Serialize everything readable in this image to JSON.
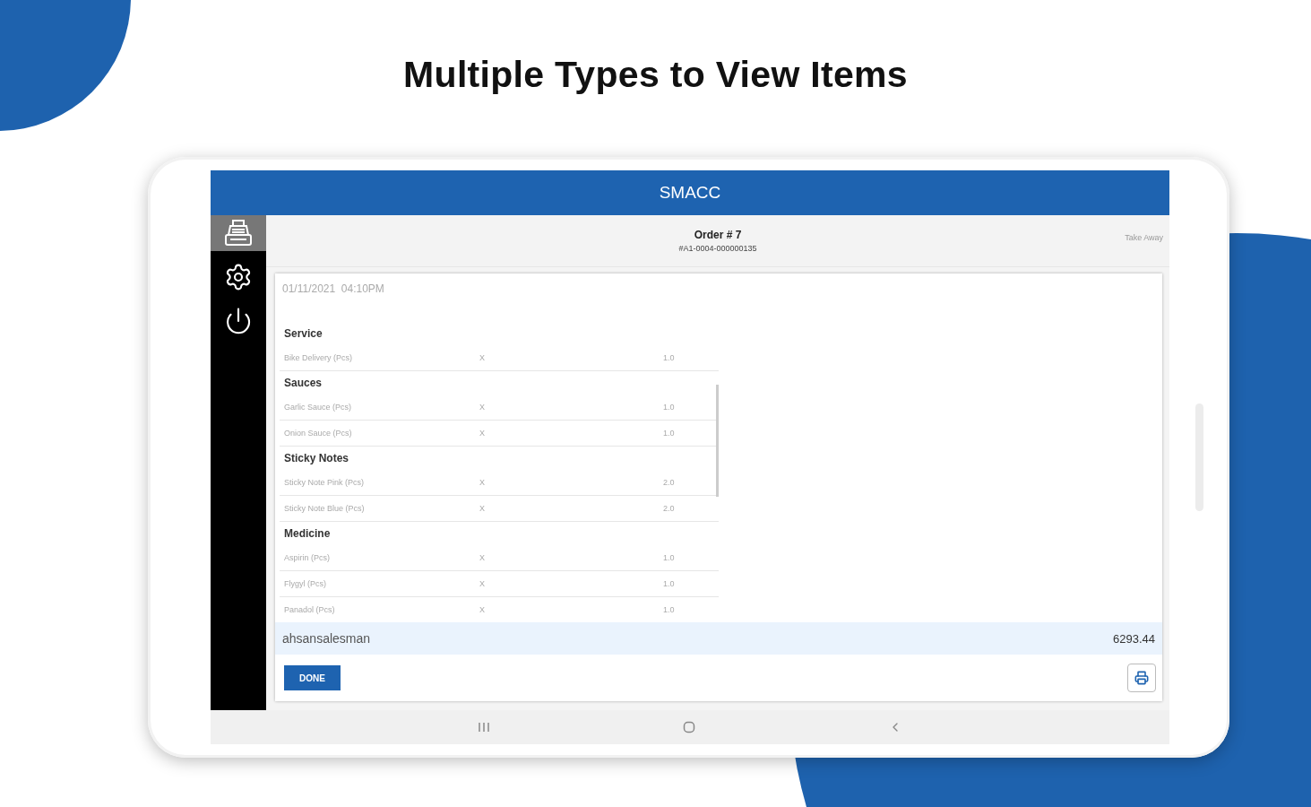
{
  "headline": "Multiple Types to View Items",
  "app": {
    "title": "SMACC",
    "sidebar": {
      "items": [
        {
          "kind": "register",
          "selected": true
        },
        {
          "kind": "settings",
          "selected": false
        },
        {
          "kind": "power",
          "selected": false
        }
      ]
    },
    "order": {
      "title": "Order # 7",
      "number": "#A1-0004-000000135",
      "type": "Take Away"
    },
    "receipt": {
      "date": "01/11/2021  04:10PM",
      "groups": [
        {
          "name": "Service",
          "items": [
            {
              "name": "Bike Delivery (Pcs)",
              "times": "X",
              "qty": "1.0"
            }
          ]
        },
        {
          "name": "Sauces",
          "items": [
            {
              "name": "Garlic Sauce (Pcs)",
              "times": "X",
              "qty": "1.0"
            },
            {
              "name": "Onion Sauce (Pcs)",
              "times": "X",
              "qty": "1.0"
            }
          ]
        },
        {
          "name": "Sticky Notes",
          "items": [
            {
              "name": "Sticky Note Pink (Pcs)",
              "times": "X",
              "qty": "2.0"
            },
            {
              "name": "Sticky Note Blue (Pcs)",
              "times": "X",
              "qty": "2.0"
            }
          ]
        },
        {
          "name": "Medicine",
          "items": [
            {
              "name": "Aspirin (Pcs)",
              "times": "X",
              "qty": "1.0"
            },
            {
              "name": "Flygyl (Pcs)",
              "times": "X",
              "qty": "1.0"
            },
            {
              "name": "Panadol (Pcs)",
              "times": "X",
              "qty": "1.0"
            }
          ]
        }
      ],
      "salesman": "ahsansalesman",
      "total": "6293.44",
      "done_button": "DONE"
    }
  }
}
